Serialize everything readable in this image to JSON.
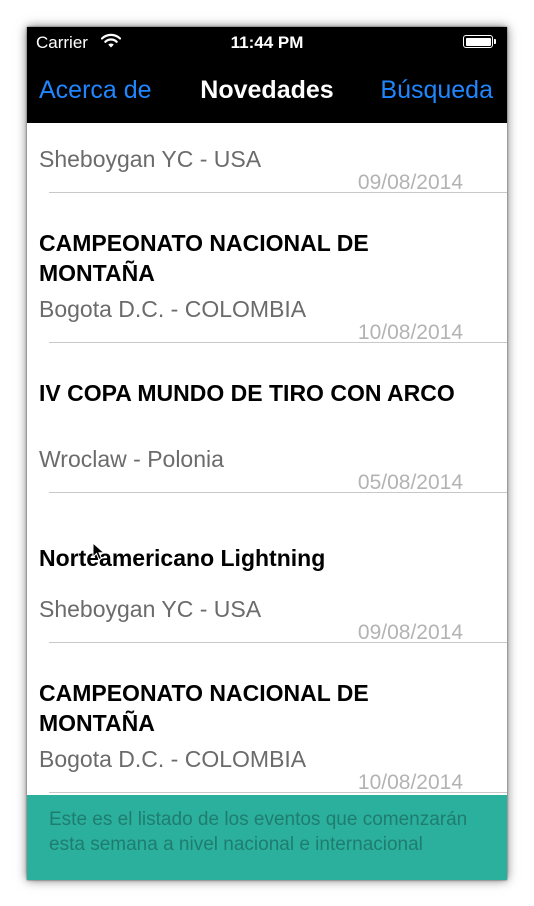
{
  "status_bar": {
    "carrier": "Carrier",
    "time": "11:44 PM",
    "wifi_icon": "wifi-icon",
    "battery_icon": "battery-icon"
  },
  "nav": {
    "left_label": "Acerca de",
    "title": "Novedades",
    "right_label": "Búsqueda"
  },
  "events": [
    {
      "title": "",
      "location": "Sheboygan YC - USA",
      "date": "09/08/2014"
    },
    {
      "title": "CAMPEONATO NACIONAL DE MONTAÑA",
      "location": "Bogota D.C. - COLOMBIA",
      "date": "10/08/2014"
    },
    {
      "title": "IV COPA MUNDO DE TIRO CON ARCO",
      "location": "Wroclaw - Polonia",
      "date": "05/08/2014"
    },
    {
      "title": "Norteamericano Lightning",
      "location": "Sheboygan YC - USA",
      "date": "09/08/2014"
    },
    {
      "title": "CAMPEONATO NACIONAL DE MONTAÑA",
      "location": "Bogota D.C. - COLOMBIA",
      "date": "10/08/2014"
    }
  ],
  "footer": {
    "text": "Este es el listado de los eventos que comenzarán esta semana a nivel nacional e internacional"
  },
  "colors": {
    "accent": "#1f86ff",
    "footer_bg": "#2bb09d",
    "footer_text": "#1f7d70",
    "date_text": "#b3b3b3",
    "location_text": "#6b6b6b"
  }
}
